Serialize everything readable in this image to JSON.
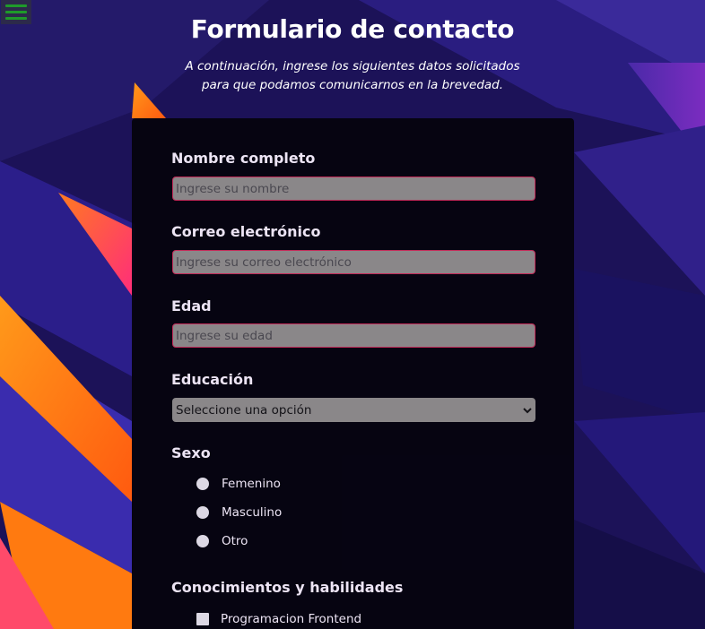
{
  "header": {
    "title": "Formulario de contacto",
    "subtitle_line1": "A continuación, ingrese los siguientes datos solicitados",
    "subtitle_line2": "para que podamos comunicarnos en la brevedad."
  },
  "menu": {
    "icon": "hamburger-menu-icon",
    "color": "#1f9a2a"
  },
  "form": {
    "name": {
      "label": "Nombre completo",
      "placeholder": "Ingrese su nombre"
    },
    "email": {
      "label": "Correo electrónico",
      "placeholder": "Ingrese su correo electrónico"
    },
    "age": {
      "label": "Edad",
      "placeholder": "Ingrese su edad"
    },
    "education": {
      "label": "Educación",
      "selected": "Seleccione una opción",
      "icon": "chevron-down-icon"
    },
    "sex": {
      "label": "Sexo",
      "options": [
        "Femenino",
        "Masculino",
        "Otro"
      ]
    },
    "skills": {
      "label": "Conocimientos y habilidades",
      "options": [
        "Programacion Frontend"
      ]
    }
  },
  "colors": {
    "panel": "#04030a",
    "field_border": "#c22a58",
    "field_bg": "#8a8789"
  }
}
